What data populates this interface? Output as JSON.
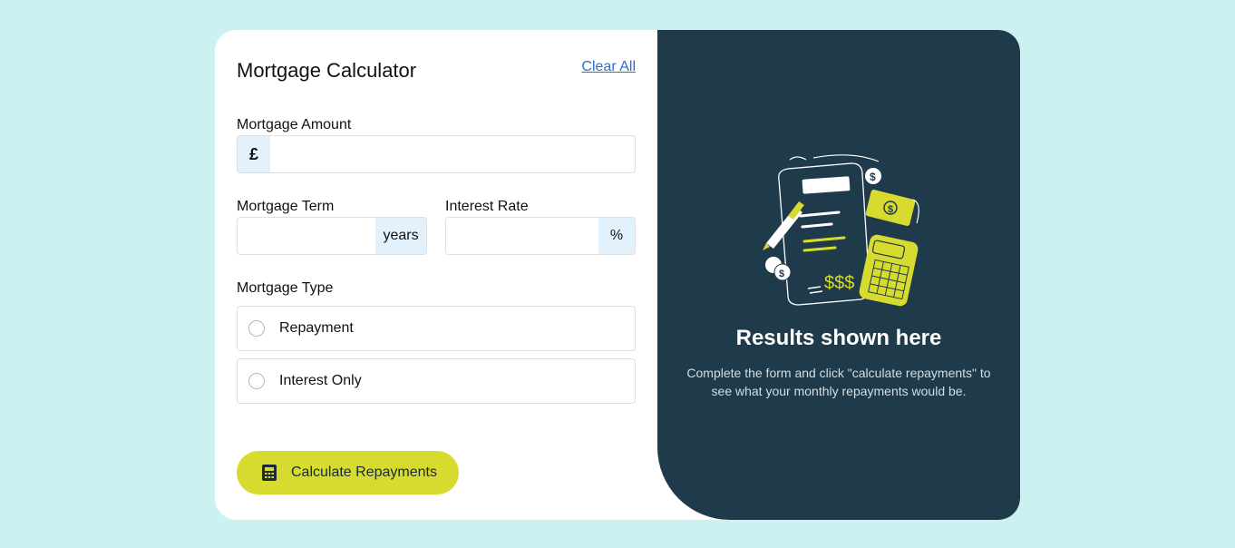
{
  "form": {
    "title": "Mortgage Calculator",
    "clear_label": "Clear All",
    "amount": {
      "label": "Mortgage Amount",
      "prefix": "£",
      "value": ""
    },
    "term": {
      "label": "Mortgage Term",
      "suffix": "years",
      "value": ""
    },
    "rate": {
      "label": "Interest Rate",
      "suffix": "%",
      "value": ""
    },
    "type": {
      "label": "Mortgage Type",
      "options": [
        {
          "label": "Repayment",
          "selected": false
        },
        {
          "label": "Interest Only",
          "selected": false
        }
      ]
    },
    "calculate_label": "Calculate Repayments",
    "calculate_icon": "calculator-icon"
  },
  "results": {
    "title": "Results shown here",
    "text": "Complete the form and click \"calculate repayments\" to see what your monthly repayments would be.",
    "illustration_icon": "empty-results-illustration"
  },
  "colors": {
    "background": "#cdf0f0",
    "accent": "#d8db2f",
    "results_bg": "#1f3a4a",
    "link": "#2a6fd6",
    "addon_bg": "#e2f1fb"
  }
}
